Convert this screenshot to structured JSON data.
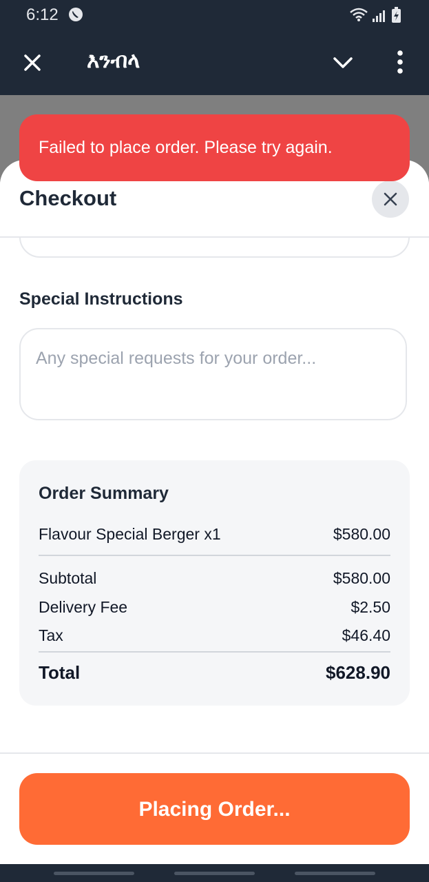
{
  "status_bar": {
    "time": "6:12",
    "icons": [
      "app-notification-icon",
      "wifi-icon",
      "signal-icon",
      "battery-charging-icon"
    ]
  },
  "app_bar": {
    "title": "እንብላ",
    "icons": [
      "close-icon",
      "chevron-down-icon",
      "more-vertical-icon"
    ]
  },
  "toast": {
    "message": "Failed to place order. Please try again.",
    "color": "#ef4444"
  },
  "checkout": {
    "title": "Checkout",
    "special_instructions": {
      "label": "Special Instructions",
      "placeholder": "Any special requests for your order...",
      "value": ""
    },
    "order_summary": {
      "title": "Order Summary",
      "items": [
        {
          "name": "Flavour Special Berger x1",
          "price": "$580.00"
        }
      ],
      "subtotal_label": "Subtotal",
      "subtotal": "$580.00",
      "delivery_fee_label": "Delivery Fee",
      "delivery_fee": "$2.50",
      "tax_label": "Tax",
      "tax": "$46.40",
      "total_label": "Total",
      "total": "$628.90"
    },
    "place_order_button": "Placing Order...",
    "accent_color": "#ff6b35"
  }
}
